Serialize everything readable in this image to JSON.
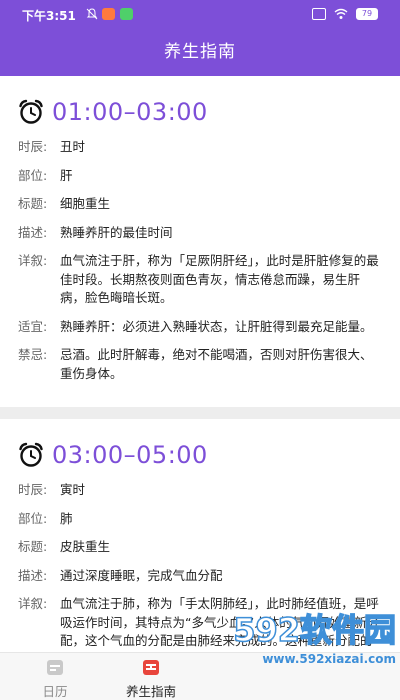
{
  "status_bar": {
    "time": "下午3:51",
    "battery": "79"
  },
  "header": {
    "title": "养生指南"
  },
  "colors": {
    "accent": "#7d4fd8",
    "separator": "#ededed"
  },
  "entries": [
    {
      "time_range": "01:00–03:00",
      "icon": "alarm-clock-icon",
      "rows": [
        {
          "label": "时辰:",
          "value": "丑时"
        },
        {
          "label": "部位:",
          "value": "肝"
        },
        {
          "label": "标题:",
          "value": "细胞重生"
        },
        {
          "label": "描述:",
          "value": "熟睡养肝的最佳时间"
        },
        {
          "label": "详叙:",
          "value": "血气流注于肝，称为「足厥阴肝经」，此时是肝脏修复的最佳时段。长期熬夜则面色青灰，情志倦怠而躁，易生肝病，脸色晦暗长斑。"
        },
        {
          "label": "适宜:",
          "value": "熟睡养肝：必须进入熟睡状态，让肝脏得到最充足能量。"
        },
        {
          "label": "禁忌:",
          "value": "忌酒。此时肝解毒，绝对不能喝酒，否则对肝伤害很大、重伤身体。"
        }
      ]
    },
    {
      "time_range": "03:00–05:00",
      "icon": "alarm-clock-icon",
      "rows": [
        {
          "label": "时辰:",
          "value": "寅时"
        },
        {
          "label": "部位:",
          "value": "肺"
        },
        {
          "label": "标题:",
          "value": "皮肤重生"
        },
        {
          "label": "描述:",
          "value": "通过深度睡眠，完成气血分配"
        },
        {
          "label": "详叙:",
          "value": "血气流注于肺，称为「手太阴肺经」，此时肺经值班，是呼吸运作时间，其特点为“多气少血。”人体的气血开始重新分配，这个气血的分配是由肺经来完成的。这种重新分配的过程，一定要在深度睡眠当中来完成，如果在寅时经常醒来，则为气血不足的表现，应加以注意。"
        }
      ]
    }
  ],
  "bottom_nav": {
    "tabs": [
      {
        "label": "日历",
        "icon": "calendar-icon",
        "active": false
      },
      {
        "label": "养生指南",
        "icon": "guide-icon",
        "active": true
      }
    ]
  },
  "watermark": {
    "brand": "592软件园",
    "url": "www.592xiazai.com"
  }
}
